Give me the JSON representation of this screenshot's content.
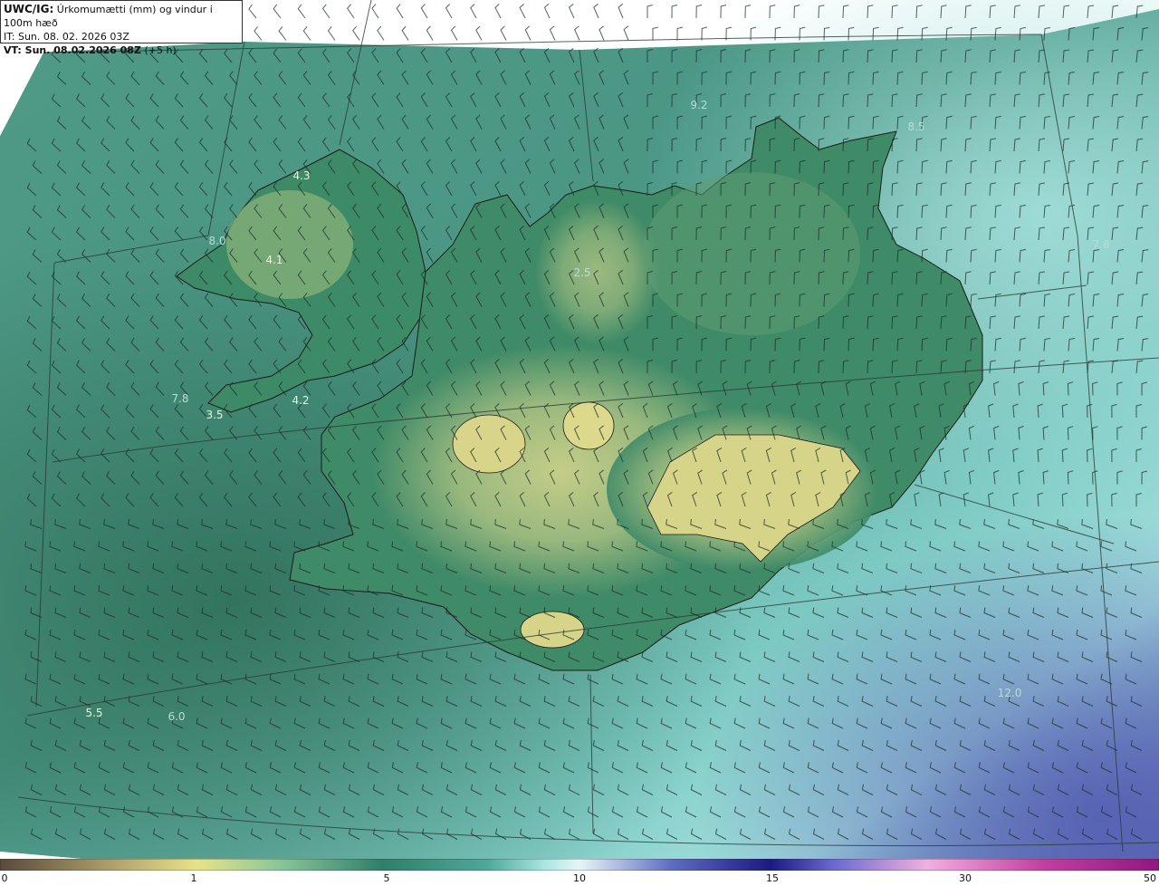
{
  "header": {
    "model_prefix": "UWC/IG:",
    "title": "Úrkomumætti (mm) og vindur i 100m hæð",
    "init_time": "IT: Sun. 08. 02. 2026 03Z",
    "valid_prefix": "VT: Sun. 08.02.2026 08Z",
    "valid_suffix": "(+5 h)"
  },
  "map": {
    "region": "Iceland",
    "field": "precipitable water",
    "overlay": "wind barbs at 100m",
    "colors": {
      "ocean_sw": "#3f8872",
      "land_low": "#3a7d5f",
      "land_high": "#c9cf86",
      "ocean_se": "#8fd8d6",
      "ocean_far_se": "#5d66b6",
      "coastline": "#1a1a1a",
      "grid": "#2a3a36",
      "barb": "#1e2e2a"
    },
    "value_labels": [
      {
        "text": "4.3",
        "style": "bright"
      },
      {
        "text": "4.1",
        "style": "bright"
      },
      {
        "text": "8.0",
        "style": "faint"
      },
      {
        "text": "7.8",
        "style": "faint"
      },
      {
        "text": "3.5",
        "style": "bright"
      },
      {
        "text": "4.2",
        "style": "bright"
      },
      {
        "text": "2.5",
        "style": "faint"
      },
      {
        "text": "7.8",
        "style": "faint"
      },
      {
        "text": "5.5",
        "style": "bright"
      },
      {
        "text": "6.0",
        "style": "faint"
      },
      {
        "text": "12.0",
        "style": "faint"
      },
      {
        "text": "9.2",
        "style": "faint"
      },
      {
        "text": "8.5",
        "style": "faint"
      }
    ]
  },
  "colorbar": {
    "ticks": [
      "0",
      "1",
      "5",
      "10",
      "15",
      "30",
      "50"
    ],
    "stops": [
      "#5a4a3a",
      "#a89a6a",
      "#e8e28a",
      "#8ac79a",
      "#2f7f6a",
      "#4fa79a",
      "#a8e6e2",
      "#e6f6f6",
      "#5e6cc0",
      "#1a1a80",
      "#6a6ad0",
      "#f0b0e0",
      "#c040a0",
      "#901880"
    ]
  }
}
